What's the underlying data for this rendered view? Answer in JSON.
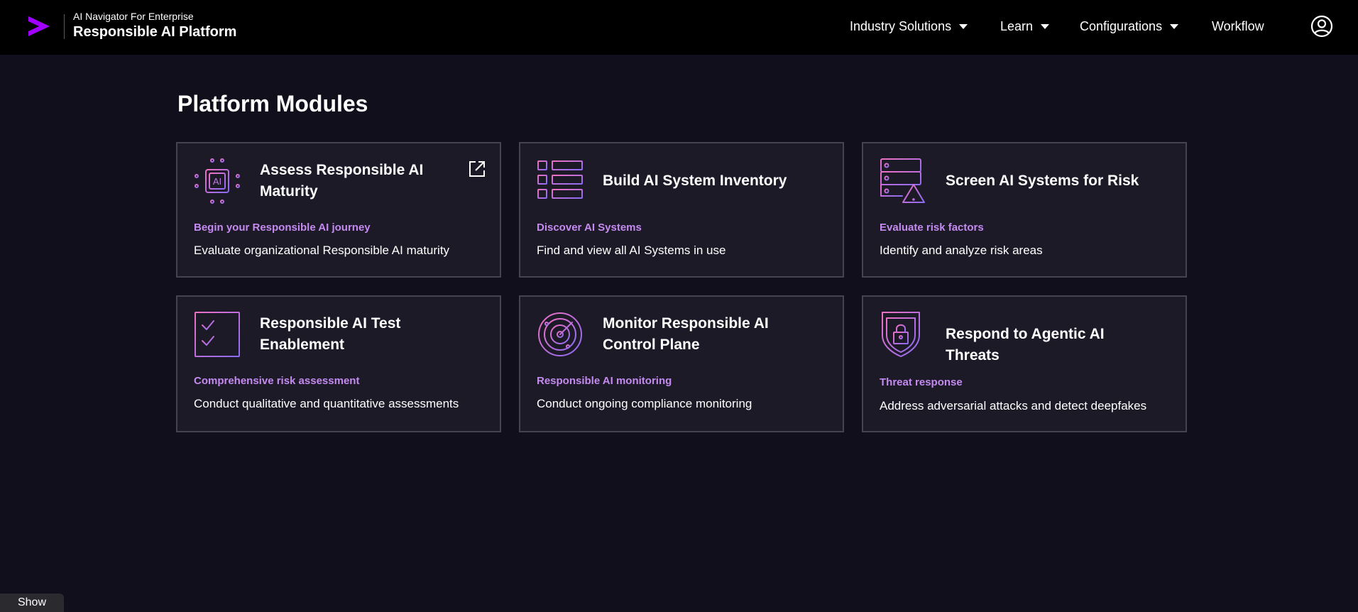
{
  "header": {
    "brand_subtitle": "AI Navigator For Enterprise",
    "brand_title": "Responsible AI Platform",
    "logo_icon": "accenture-greater-than-logo",
    "nav": [
      {
        "label": "Industry Solutions",
        "has_dropdown": true
      },
      {
        "label": "Learn",
        "has_dropdown": true
      },
      {
        "label": "Configurations",
        "has_dropdown": true
      },
      {
        "label": "Workflow",
        "has_dropdown": false
      }
    ],
    "user_icon": "user-account-icon"
  },
  "main": {
    "title": "Platform Modules",
    "cards": [
      {
        "title": "Assess Responsible AI Maturity",
        "subtitle": "Begin your Responsible AI journey",
        "description": "Evaluate organizational Responsible AI maturity",
        "icon": "ai-chip-icon",
        "external_link": true
      },
      {
        "title": "Build AI System Inventory",
        "subtitle": "Discover AI Systems",
        "description": "Find and view all AI Systems in use",
        "icon": "inventory-list-icon",
        "external_link": false
      },
      {
        "title": "Screen AI Systems for Risk",
        "subtitle": "Evaluate risk factors",
        "description": "Identify and analyze risk areas",
        "icon": "server-warning-icon",
        "external_link": false
      },
      {
        "title": "Responsible AI Test Enablement",
        "subtitle": "Comprehensive risk assessment",
        "description": "Conduct qualitative and quantitative assessments",
        "icon": "checklist-icon",
        "external_link": false
      },
      {
        "title": "Monitor Responsible AI Control Plane",
        "subtitle": "Responsible AI monitoring",
        "description": "Conduct ongoing compliance monitoring",
        "icon": "radar-icon",
        "external_link": false
      },
      {
        "title": "Respond to Agentic AI Threats",
        "subtitle": "Threat response",
        "description": "Address adversarial attacks and detect deepfakes",
        "icon": "shield-lock-icon",
        "external_link": false
      }
    ]
  },
  "footer": {
    "show_label": "Show"
  },
  "colors": {
    "background": "#110f1c",
    "header_background": "#000000",
    "card_background": "#1d1a28",
    "card_border": "#46434f",
    "accent_purple": "#a100ff",
    "subtitle_purple": "#c48af0",
    "icon_gradient_start": "#e96fc8",
    "icon_gradient_end": "#8a6cf0"
  }
}
